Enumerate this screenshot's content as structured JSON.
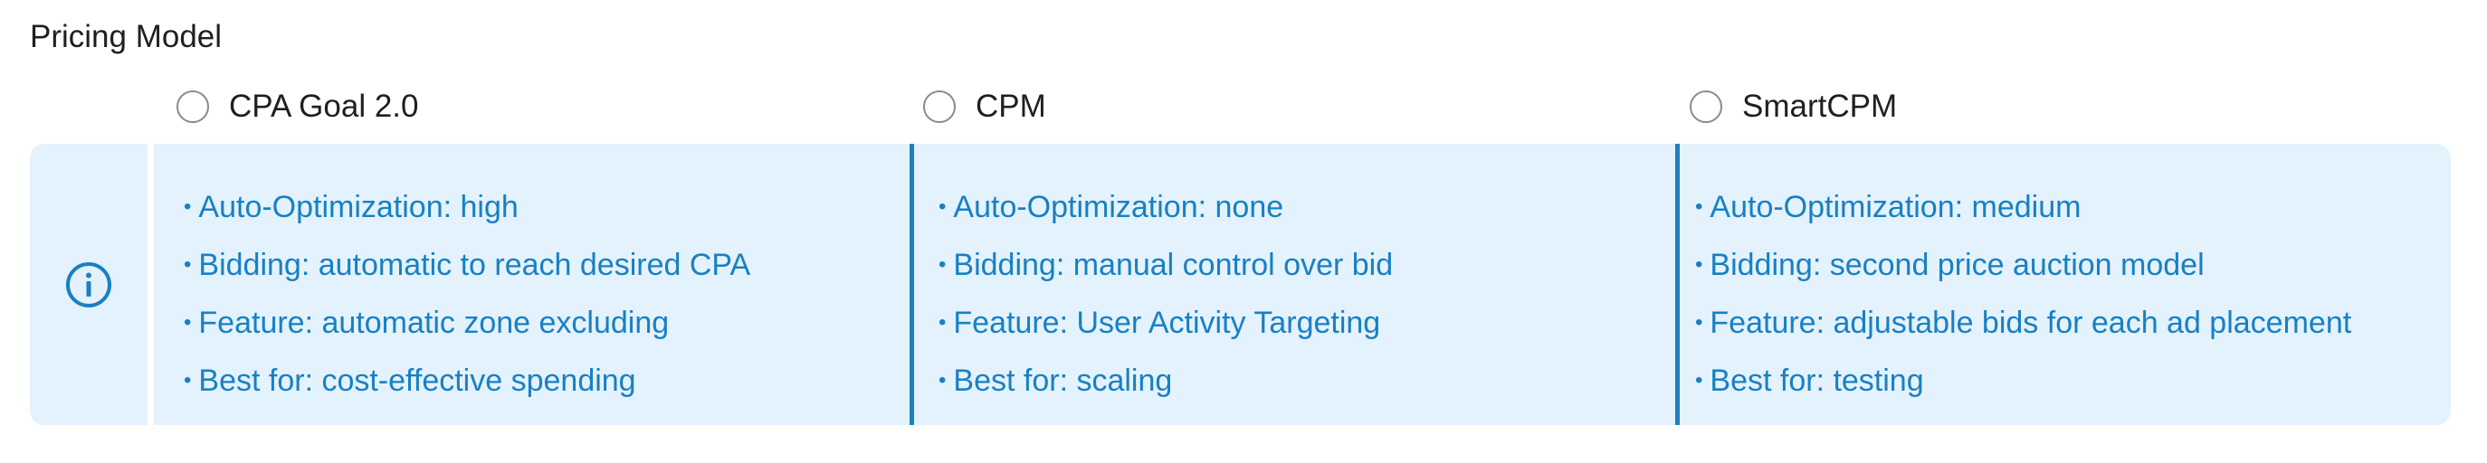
{
  "section": {
    "title": "Pricing Model"
  },
  "options": [
    {
      "label": "CPA Goal 2.0",
      "selected": false
    },
    {
      "label": "CPM",
      "selected": false
    },
    {
      "label": "SmartCPM",
      "selected": false
    }
  ],
  "info": {
    "icon": "info-circle-icon",
    "columns": [
      {
        "items": [
          "Auto-Optimization: high",
          "Bidding: automatic to reach desired CPA",
          "Feature: automatic zone excluding",
          "Best for: cost-effective spending"
        ]
      },
      {
        "items": [
          "Auto-Optimization: none",
          "Bidding: manual control over bid",
          "Feature: User Activity Targeting",
          "Best for: scaling"
        ]
      },
      {
        "items": [
          "Auto-Optimization: medium",
          "Bidding: second price auction model",
          "Feature: adjustable bids for each ad placement",
          "Best for: testing"
        ]
      }
    ]
  },
  "colors": {
    "accent": "#1880c4",
    "panel_background": "#e3f2fc",
    "divider": "#1f7fc4",
    "text": "#1f1f1f",
    "radio_border": "#8a8a8a"
  }
}
